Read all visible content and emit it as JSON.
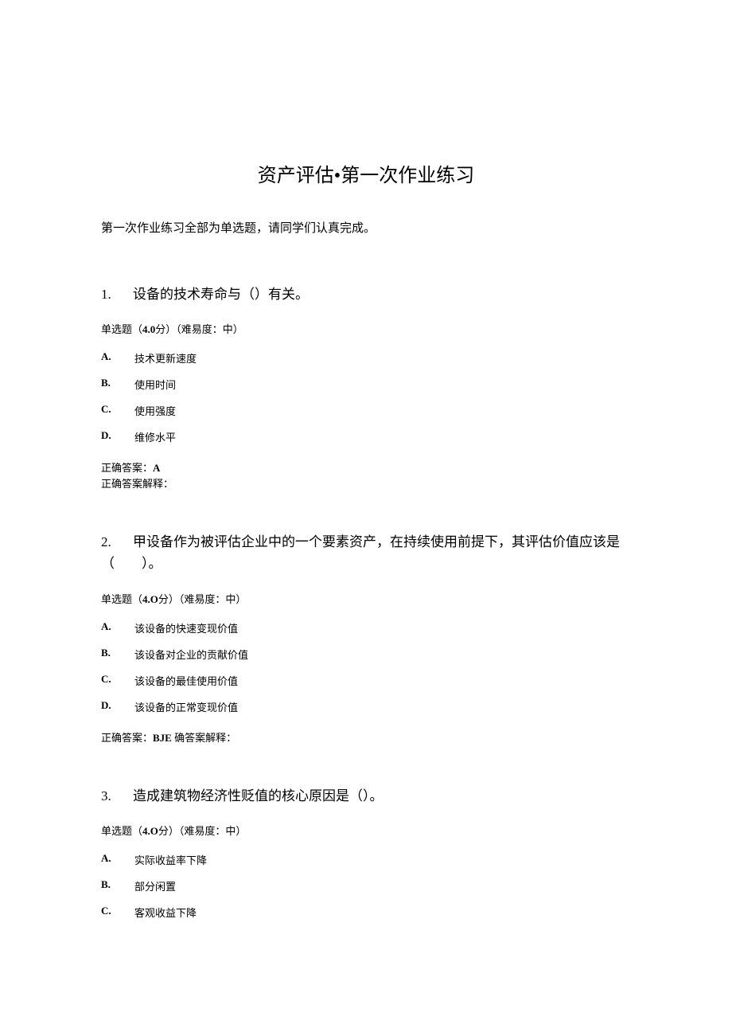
{
  "title": "资产评估•第一次作业练习",
  "intro": "第一次作业练习全部为单选题，请同学们认真完成。",
  "questions": [
    {
      "number": "1.",
      "title": "设备的技术寿命与（）有关。",
      "meta_type": "单选题",
      "meta_score_open": "（",
      "meta_score_value": "4.0",
      "meta_score_unit": "分）",
      "meta_diff": "（难易度：中）",
      "options": [
        {
          "letter": "A.",
          "text": "技术更新速度"
        },
        {
          "letter": "B.",
          "text": "使用时间"
        },
        {
          "letter": "C.",
          "text": "使用强度"
        },
        {
          "letter": "D.",
          "text": "维修水平"
        }
      ],
      "answer_label": "正确答案：",
      "answer_value": "A",
      "explain_label": "正确答案解释：",
      "explain_value": "",
      "answer_layout": "stacked"
    },
    {
      "number": "2.",
      "title": "甲设备作为被评估企业中的一个要素资产，在持续使用前提下，其评估价值应该是（　　）。",
      "meta_type": "单选题",
      "meta_score_open": "（",
      "meta_score_value": "4.O",
      "meta_score_unit": "分）",
      "meta_diff": "（难易度：中）",
      "options": [
        {
          "letter": "A.",
          "text": "该设备的快速变现价值"
        },
        {
          "letter": "B.",
          "text": "该设备对企业的贡献价值"
        },
        {
          "letter": "C.",
          "text": "该设备的最佳使用价值"
        },
        {
          "letter": "D.",
          "text": "该设备的正常变现价值"
        }
      ],
      "answer_label": "正确答案：",
      "answer_value": "BJE",
      "explain_label": "确答案解释：",
      "explain_value": "",
      "answer_layout": "inline"
    },
    {
      "number": "3.",
      "title": "造成建筑物经济性贬值的核心原因是（）。",
      "meta_type": "单选题",
      "meta_score_open": "（",
      "meta_score_value": "4.O",
      "meta_score_unit": "分）",
      "meta_diff": "（难易度：中）",
      "options": [
        {
          "letter": "A.",
          "text": "实际收益率下降"
        },
        {
          "letter": "B.",
          "text": "部分闲置"
        },
        {
          "letter": "C.",
          "text": "客观收益下降"
        }
      ],
      "answer_label": "",
      "answer_value": "",
      "explain_label": "",
      "explain_value": "",
      "answer_layout": "none"
    }
  ]
}
